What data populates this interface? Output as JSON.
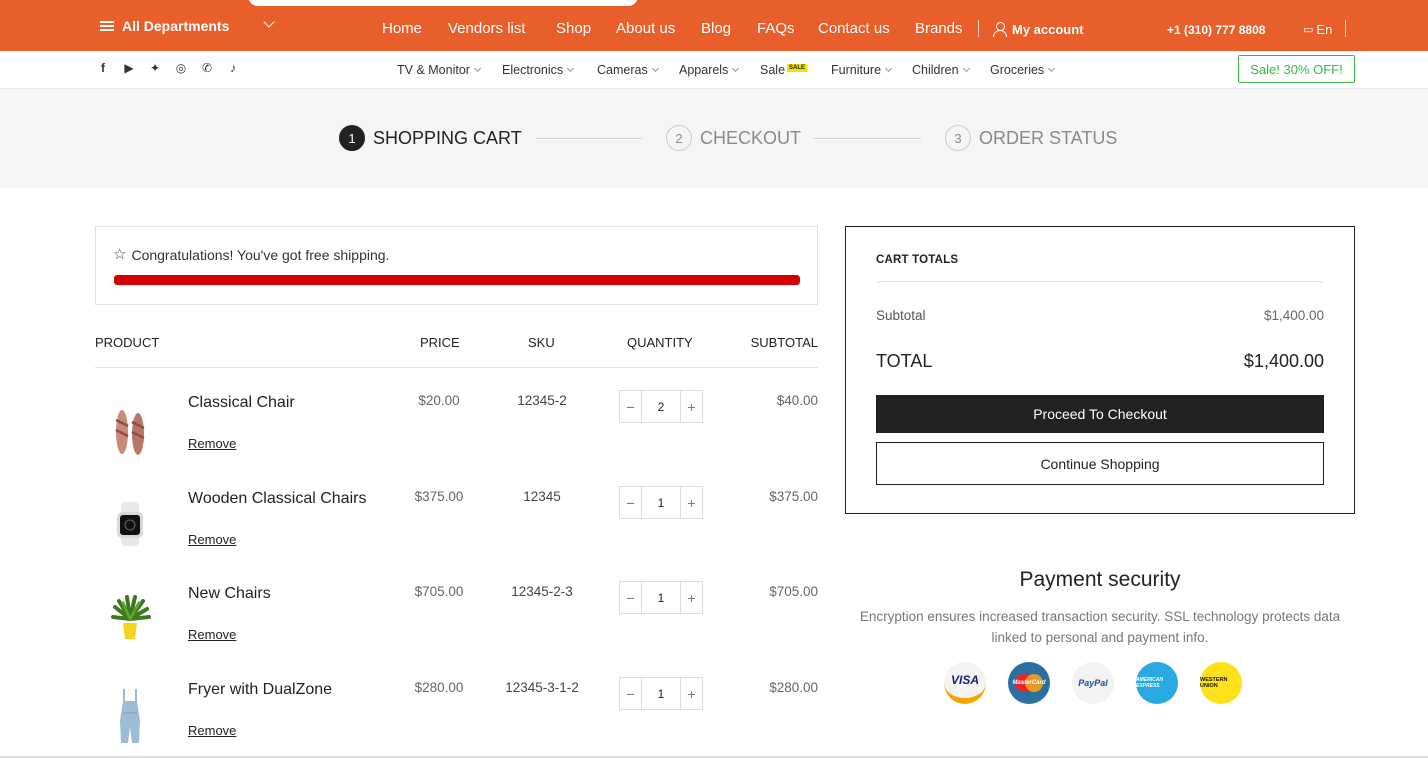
{
  "topbar": {
    "departments_label": "All Departments",
    "nav": [
      "Home",
      "Vendors list",
      "Shop",
      "About us",
      "Blog",
      "FAQs",
      "Contact us",
      "Brands"
    ],
    "account_label": "My account",
    "phone": "+1 (310) 777 8808",
    "language": "En",
    "accent_color": "#e85f2c"
  },
  "subbar": {
    "socials": [
      "facebook-icon",
      "youtube-icon",
      "twitter-icon",
      "instagram-icon",
      "whatsapp-icon",
      "tiktok-icon"
    ],
    "categories": [
      "TV & Monitor",
      "Electronics",
      "Cameras",
      "Apparels",
      "Sale",
      "Furniture",
      "Children",
      "Groceries"
    ],
    "sale_tag": "SALE",
    "sale_button": "Sale! 30% OFF!"
  },
  "steps": [
    {
      "num": "1",
      "label": "SHOPPING CART"
    },
    {
      "num": "2",
      "label": "CHECKOUT"
    },
    {
      "num": "3",
      "label": "ORDER STATUS"
    }
  ],
  "shipping": {
    "message": "Congratulations! You've got free shipping.",
    "progress_percent": 100,
    "bar_color": "#d50000"
  },
  "table": {
    "headers": [
      "PRODUCT",
      "PRICE",
      "SKU",
      "QUANTITY",
      "SUBTOTAL"
    ],
    "remove_label": "Remove",
    "rows": [
      {
        "name": "Classical Chair",
        "price": "$20.00",
        "sku": "12345-2",
        "qty": "2",
        "subtotal": "$40.00",
        "image": "sandals"
      },
      {
        "name": "Wooden Classical Chairs",
        "price": "$375.00",
        "sku": "12345",
        "qty": "1",
        "subtotal": "$375.00",
        "image": "smartwatch"
      },
      {
        "name": "New Chairs",
        "price": "$705.00",
        "sku": "12345-2-3",
        "qty": "1",
        "subtotal": "$705.00",
        "image": "potted-plant"
      },
      {
        "name": "Fryer with DualZone",
        "price": "$280.00",
        "sku": "12345-3-1-2",
        "qty": "1",
        "subtotal": "$280.00",
        "image": "denim-romper"
      }
    ]
  },
  "totals": {
    "title": "CART TOTALS",
    "subtotal_label": "Subtotal",
    "subtotal_value": "$1,400.00",
    "total_label": "TOTAL",
    "total_value": "$1,400.00",
    "checkout_label": "Proceed To Checkout",
    "continue_label": "Continue Shopping"
  },
  "payment": {
    "title": "Payment security",
    "description": "Encryption ensures increased transaction security. SSL technology protects data linked to personal and payment info.",
    "cards": [
      "VISA",
      "MasterCard",
      "PayPal",
      "AMERICAN EXPRESS",
      "WESTERN UNION"
    ]
  }
}
